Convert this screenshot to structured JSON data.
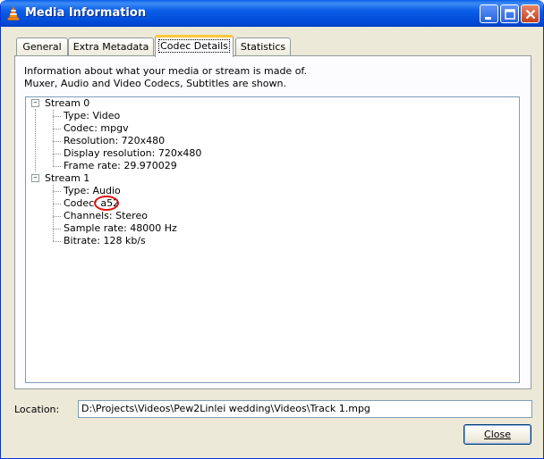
{
  "window": {
    "title": "Media Information",
    "icon": "vlc-cone-icon",
    "buttons": [
      "minimize-icon",
      "maximize-icon",
      "close-icon"
    ]
  },
  "tabs": [
    {
      "label": "General",
      "active": false
    },
    {
      "label": "Extra Metadata",
      "active": false
    },
    {
      "label": "Codec Details",
      "active": true
    },
    {
      "label": "Statistics",
      "active": false
    }
  ],
  "panel": {
    "info_line1": "Information about what your media or stream is made of.",
    "info_line2": "Muxer, Audio and Video Codecs, Subtitles are shown."
  },
  "tree": {
    "streams": [
      {
        "label": "Stream 0",
        "expanded": true,
        "items": [
          "Type: Video",
          "Codec: mpgv",
          "Resolution: 720x480",
          "Display resolution: 720x480",
          "Frame rate: 29.970029"
        ]
      },
      {
        "label": "Stream 1",
        "expanded": true,
        "items": [
          "Type: Audio",
          "Codec: a52",
          "Channels: Stereo",
          "Sample rate: 48000 Hz",
          "Bitrate: 128 kb/s"
        ]
      }
    ],
    "highlighted_value": "a52",
    "highlight_color": "#e01010"
  },
  "location": {
    "label": "Location:",
    "value": "D:\\Projects\\Videos\\Pew2Linlei wedding\\Videos\\Track 1.mpg"
  },
  "close_button": {
    "label": "Close"
  },
  "colors": {
    "titlebar": "#0a5ee8",
    "active_tab_accent": "#ffc83c",
    "dialog_bg": "#ece9d8"
  }
}
